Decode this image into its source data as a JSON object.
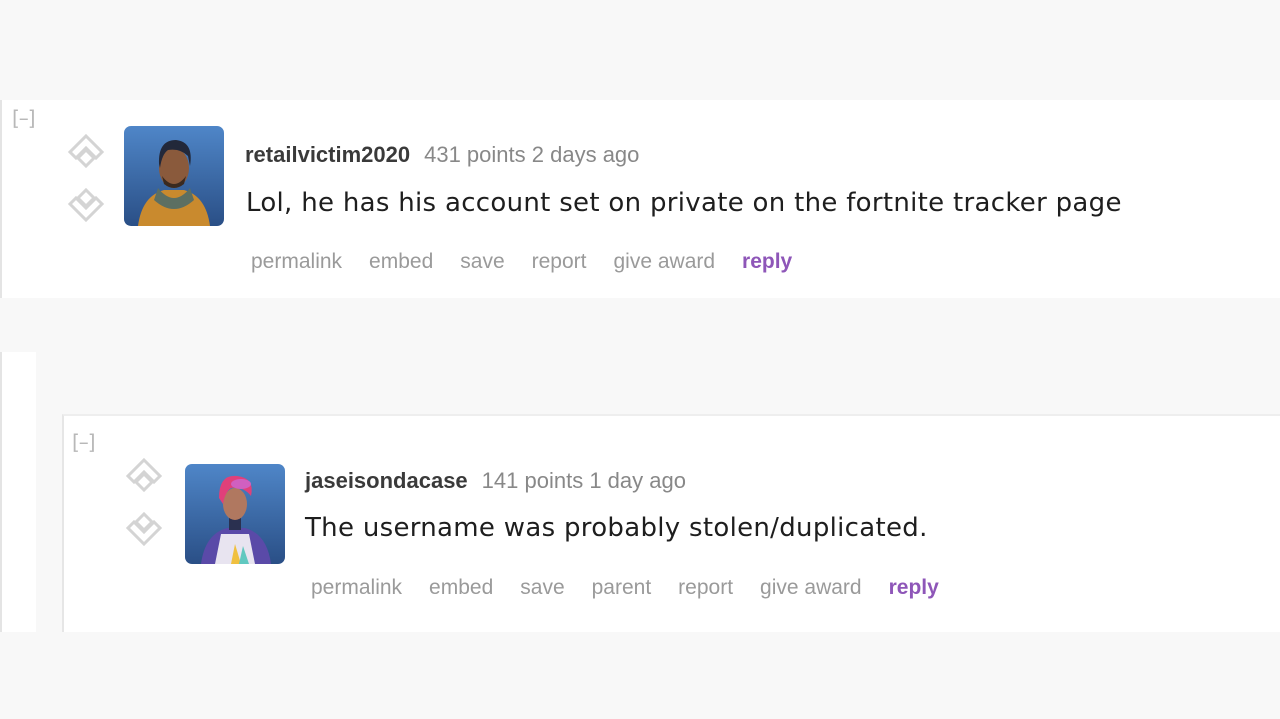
{
  "collapse_label": "[–]",
  "comments": [
    {
      "author": "retailvictim2020",
      "score": "431 points",
      "time": "2 days ago",
      "body": "Lol, he has his account set on private on the fortnite tracker page",
      "avatar": "fortnite-skin-bearded-man-avatar",
      "buttons": [
        "permalink",
        "embed",
        "save",
        "report",
        "give award"
      ],
      "reply_label": "reply"
    },
    {
      "author": "jaseisondacase",
      "score": "141 points",
      "time": "1 day ago",
      "body": "The username was probably stolen/duplicated.",
      "avatar": "fortnite-skin-pink-hair-avatar",
      "buttons": [
        "permalink",
        "embed",
        "save",
        "parent",
        "report",
        "give award"
      ],
      "reply_label": "reply"
    }
  ],
  "colors": {
    "reply": "#8e56b8",
    "background": "#f8f8f8",
    "card": "#ffffff"
  }
}
